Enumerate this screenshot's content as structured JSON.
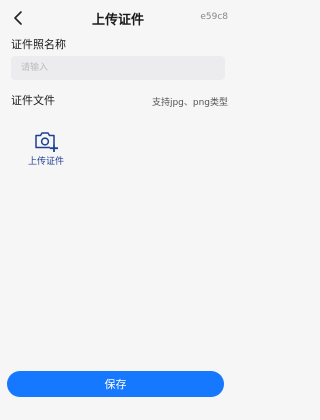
{
  "header": {
    "title": "上传证件",
    "code": "e59c8",
    "back_icon": "chevron-left-icon"
  },
  "form": {
    "name_label": "证件照名称",
    "name_placeholder": "请输入",
    "name_value": "",
    "file_label": "证件文件",
    "file_hint": "支持jpg、png类型",
    "upload_label": "上传证件",
    "upload_icon": "camera-plus-icon",
    "upload_icon_color": "#1e3f93"
  },
  "footer": {
    "save_label": "保存",
    "save_color": "#1677ff"
  }
}
